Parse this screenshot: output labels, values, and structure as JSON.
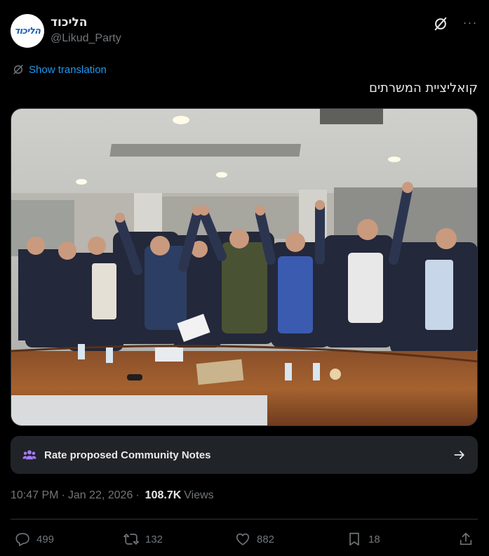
{
  "account": {
    "display_name": "הליכוד",
    "handle": "@Likud_Party",
    "avatar_text": "הליכוד"
  },
  "translation": {
    "label": "Show translation"
  },
  "tweet": {
    "text": "קואליציית המשרתים",
    "image_icon": "group-photo"
  },
  "community_notes": {
    "label": "Rate proposed Community Notes",
    "icon": "people-icon",
    "arrow": "arrow-right-icon"
  },
  "meta": {
    "time": "10:47 PM",
    "separator": "·",
    "date": "Jan 22, 2026",
    "separator2": "·",
    "views_count": "108.7K",
    "views_label": "Views"
  },
  "actions": {
    "replies": "499",
    "retweets": "132",
    "likes": "882",
    "bookmarks": "18"
  },
  "colors": {
    "accent": "#1d9bf0",
    "notes_icon": "#a77dff",
    "muted": "#71767b"
  }
}
